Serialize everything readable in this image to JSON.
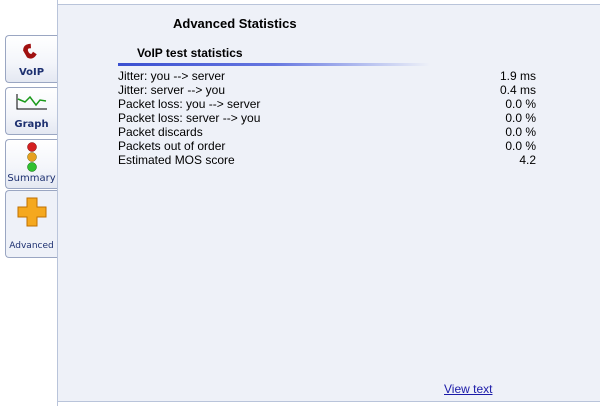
{
  "tabs": [
    {
      "id": "voip",
      "label": "VoIP"
    },
    {
      "id": "graph",
      "label": "Graph"
    },
    {
      "id": "summary",
      "label": "Summary"
    },
    {
      "id": "advanced",
      "label": "Advanced"
    }
  ],
  "panel": {
    "title": "Advanced Statistics",
    "section_title": "VoIP test statistics",
    "stats": [
      {
        "label": "Jitter: you --> server",
        "value": "1.9 ms"
      },
      {
        "label": "Jitter: server --> you",
        "value": "0.4 ms"
      },
      {
        "label": "Packet loss: you --> server",
        "value": "0.0 %"
      },
      {
        "label": "Packet loss: server --> you",
        "value": "0.0 %"
      },
      {
        "label": "Packet discards",
        "value": "0.0 %"
      },
      {
        "label": "Packets out of order",
        "value": "0.0 %"
      },
      {
        "label": "Estimated MOS score",
        "value": "4.2"
      }
    ],
    "view_text_link": "View text"
  },
  "colors": {
    "panel_bg": "#eef1f8",
    "tab_label": "#1d3070",
    "link": "#1a1aa8",
    "rule": "#3a4fd0"
  }
}
